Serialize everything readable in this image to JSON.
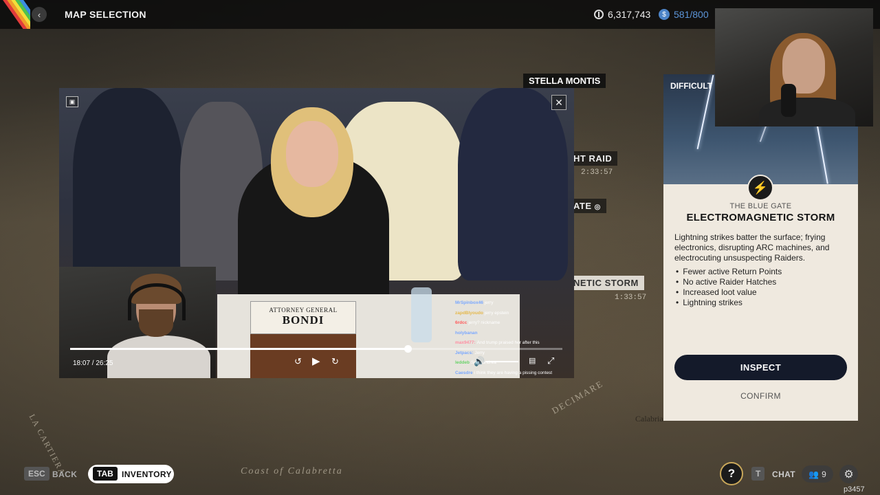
{
  "header": {
    "title": "MAP SELECTION",
    "coins": "6,317,743",
    "raider_tokens": "581/800"
  },
  "map": {
    "stella_label": "STELLA MONTIS",
    "night_raid_label": "HT RAID",
    "night_raid_time": "2:33:57",
    "gate_label": "ATE",
    "storm_label": "NETIC STORM",
    "storm_time": "1:33:57",
    "region_decimare": "DECIMARE",
    "region_cartiera": "LA CARTIERA",
    "region_calabretta": "Coast of Calabretta",
    "region_calabria": "Calabria"
  },
  "video": {
    "nameplate_sub": "ATTORNEY GENERAL",
    "nameplate_main": "BONDI",
    "time": "18:07 / 26:25",
    "progress": 0.686,
    "chat": [
      {
        "user": "MrSpinbox46",
        "text": "jerry",
        "color": "#7aa8ff"
      },
      {
        "user": "zapdBlyoudo",
        "text": "jerry epstein",
        "color": "#e5b84a"
      },
      {
        "user": "6rdcc",
        "text": "jerry? nickname",
        "color": "#ff5a5a"
      },
      {
        "user": "holybanan",
        "text": "",
        "color": "#7aa8ff"
      },
      {
        "user": "max9477:",
        "text": "And trump praised her after this",
        "color": "#ff8fa3"
      },
      {
        "user": "Jetpacs:",
        "text": "Jerry",
        "color": "#7aa8ff"
      },
      {
        "user": "leddeb",
        "text": "Scan andrea",
        "color": "#6ad26a"
      },
      {
        "user": "Caesdre",
        "text": "i think they are having a pissing contest",
        "color": "#7aa8ff"
      }
    ]
  },
  "panel": {
    "difficulty": "DIFFICULT",
    "subtitle": "THE BLUE GATE",
    "title": "ELECTROMAGNETIC STORM",
    "description": "Lightning strikes batter the surface; frying electronics, disrupting ARC machines, and electrocuting unsuspecting Raiders.",
    "effects": [
      "Fewer active Return Points",
      "No active Raider Hatches",
      "Increased loot value",
      "Lightning strikes"
    ],
    "inspect_label": "INSPECT",
    "confirm_label": "CONFIRM"
  },
  "bottom": {
    "esc_key": "ESC",
    "back_label": "BACK",
    "tab_key": "TAB",
    "inventory_label": "INVENTORY",
    "help_glyph": "?",
    "chat_key": "T",
    "chat_label": "CHAT",
    "friends_count": "9",
    "watermark": "p3457"
  },
  "colors": {
    "accent_button": "#141a2a",
    "panel_bg": "#efe9df",
    "token_blue": "#4c84c8",
    "help_ring": "#caa85a"
  }
}
